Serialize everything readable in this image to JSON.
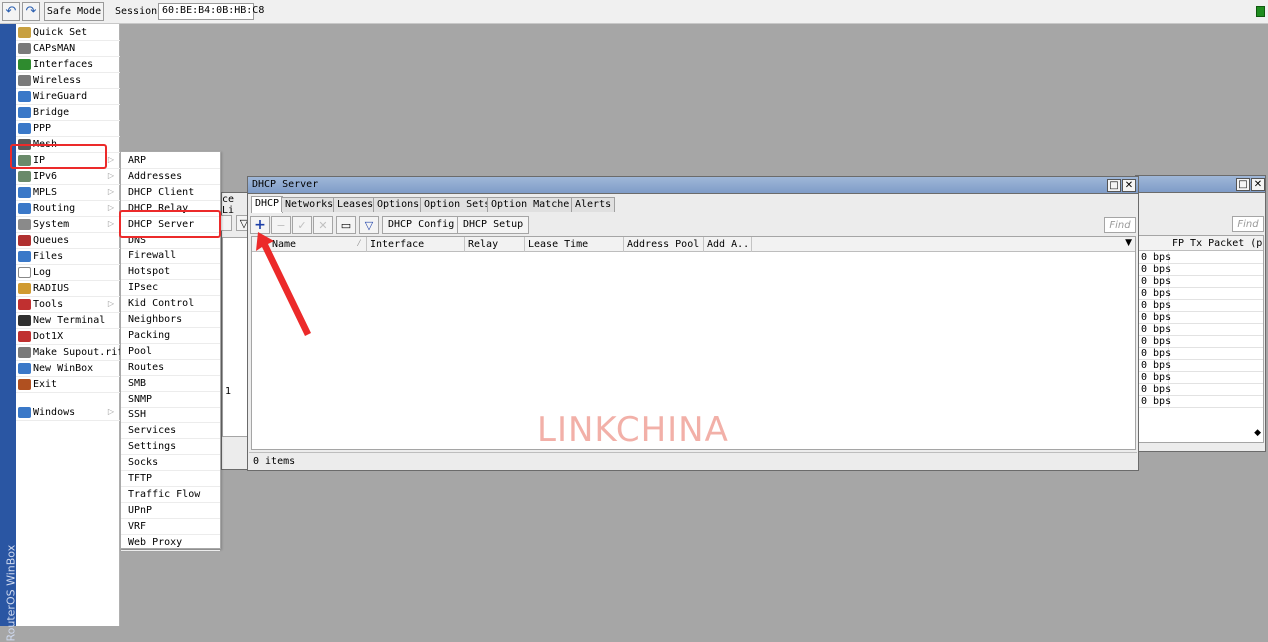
{
  "toolbar": {
    "undo_icon": "undo-icon",
    "redo_icon": "redo-icon",
    "safe_mode_label": "Safe Mode",
    "session_label": "Session:",
    "session_value": "60:BE:B4:0B:HB:C8"
  },
  "sidebar_strip_label": "RouterOS WinBox",
  "main_menu": {
    "items": [
      {
        "label": "Quick Set",
        "icon": "wand-icon",
        "color": "#c8a040",
        "submenu": false
      },
      {
        "label": "CAPsMAN",
        "icon": "antenna-icon",
        "color": "#7a7a7a",
        "submenu": false
      },
      {
        "label": "Interfaces",
        "icon": "ethernet-icon",
        "color": "#2e8b2e",
        "submenu": false
      },
      {
        "label": "Wireless",
        "icon": "wifi-icon",
        "color": "#7a7a7a",
        "submenu": false
      },
      {
        "label": "WireGuard",
        "icon": "wireguard-icon",
        "color": "#3a78c8",
        "submenu": false
      },
      {
        "label": "Bridge",
        "icon": "bridge-icon",
        "color": "#3a78c8",
        "submenu": false
      },
      {
        "label": "PPP",
        "icon": "ppp-icon",
        "color": "#3a78c8",
        "submenu": false
      },
      {
        "label": "Mesh",
        "icon": "mesh-icon",
        "color": "#5a5a5a",
        "submenu": false
      },
      {
        "label": "IP",
        "icon": "ip-icon",
        "color": "#6a8a6a",
        "submenu": true
      },
      {
        "label": "IPv6",
        "icon": "ipv6-icon",
        "color": "#6a8a6a",
        "submenu": true
      },
      {
        "label": "MPLS",
        "icon": "mpls-icon",
        "color": "#3a78c8",
        "submenu": true
      },
      {
        "label": "Routing",
        "icon": "routing-icon",
        "color": "#3a78c8",
        "submenu": true
      },
      {
        "label": "System",
        "icon": "gear-icon",
        "color": "#8a8a8a",
        "submenu": true
      },
      {
        "label": "Queues",
        "icon": "queue-icon",
        "color": "#b03030",
        "submenu": false
      },
      {
        "label": "Files",
        "icon": "folder-icon",
        "color": "#3a78c8",
        "submenu": false
      },
      {
        "label": "Log",
        "icon": "log-icon",
        "color": "#ffffff",
        "submenu": false
      },
      {
        "label": "RADIUS",
        "icon": "users-icon",
        "color": "#d09a30",
        "submenu": false
      },
      {
        "label": "Tools",
        "icon": "tools-icon",
        "color": "#c03030",
        "submenu": true
      },
      {
        "label": "New Terminal",
        "icon": "terminal-icon",
        "color": "#303030",
        "submenu": false
      },
      {
        "label": "Dot1X",
        "icon": "dot1x-icon",
        "color": "#c03030",
        "submenu": false
      },
      {
        "label": "Make Supout.rif",
        "icon": "supout-icon",
        "color": "#7a7a7a",
        "submenu": false
      },
      {
        "label": "New WinBox",
        "icon": "winbox-icon",
        "color": "#3a78c8",
        "submenu": false
      },
      {
        "label": "Exit",
        "icon": "exit-icon",
        "color": "#b05020",
        "submenu": false
      }
    ],
    "windows_label": "Windows",
    "windows_icon": "windows-icon"
  },
  "ip_submenu": {
    "items": [
      "ARP",
      "Addresses",
      "DHCP Client",
      "DHCP Relay",
      "DHCP Server",
      "DNS",
      "Firewall",
      "Hotspot",
      "IPsec",
      "Kid Control",
      "Neighbors",
      "Packing",
      "Pool",
      "Routes",
      "SMB",
      "SNMP",
      "SSH",
      "Services",
      "Settings",
      "Socks",
      "TFTP",
      "Traffic Flow",
      "UPnP",
      "VRF",
      "Web Proxy"
    ]
  },
  "back_window_left": {
    "tab_partial": "ce Li",
    "row_fragment": "1"
  },
  "back_window_right": {
    "find_placeholder": "Find",
    "column_header": "FP Tx Packet (p",
    "rows": [
      "0 bps",
      "0 bps",
      "0 bps",
      "0 bps",
      "0 bps",
      "0 bps",
      "0 bps",
      "0 bps",
      "0 bps",
      "0 bps",
      "0 bps",
      "0 bps",
      "0 bps"
    ]
  },
  "dhcp_window": {
    "title": "DHCP Server",
    "tabs": [
      "DHCP",
      "Networks",
      "Leases",
      "Options",
      "Option Sets",
      "Option Matcher",
      "Alerts"
    ],
    "buttons": {
      "add": "+",
      "remove": "−",
      "enable": "✓",
      "disable": "✕",
      "comment": "▭",
      "filter": "▽",
      "config": "DHCP Config",
      "setup": "DHCP Setup"
    },
    "find_placeholder": "Find",
    "columns": [
      "Name",
      "Interface",
      "Relay",
      "Lease Time",
      "Address Pool",
      "Add A..."
    ],
    "status": "0 items"
  },
  "watermark": "LINKCHINA",
  "annotation_color": "#ec2a2a"
}
